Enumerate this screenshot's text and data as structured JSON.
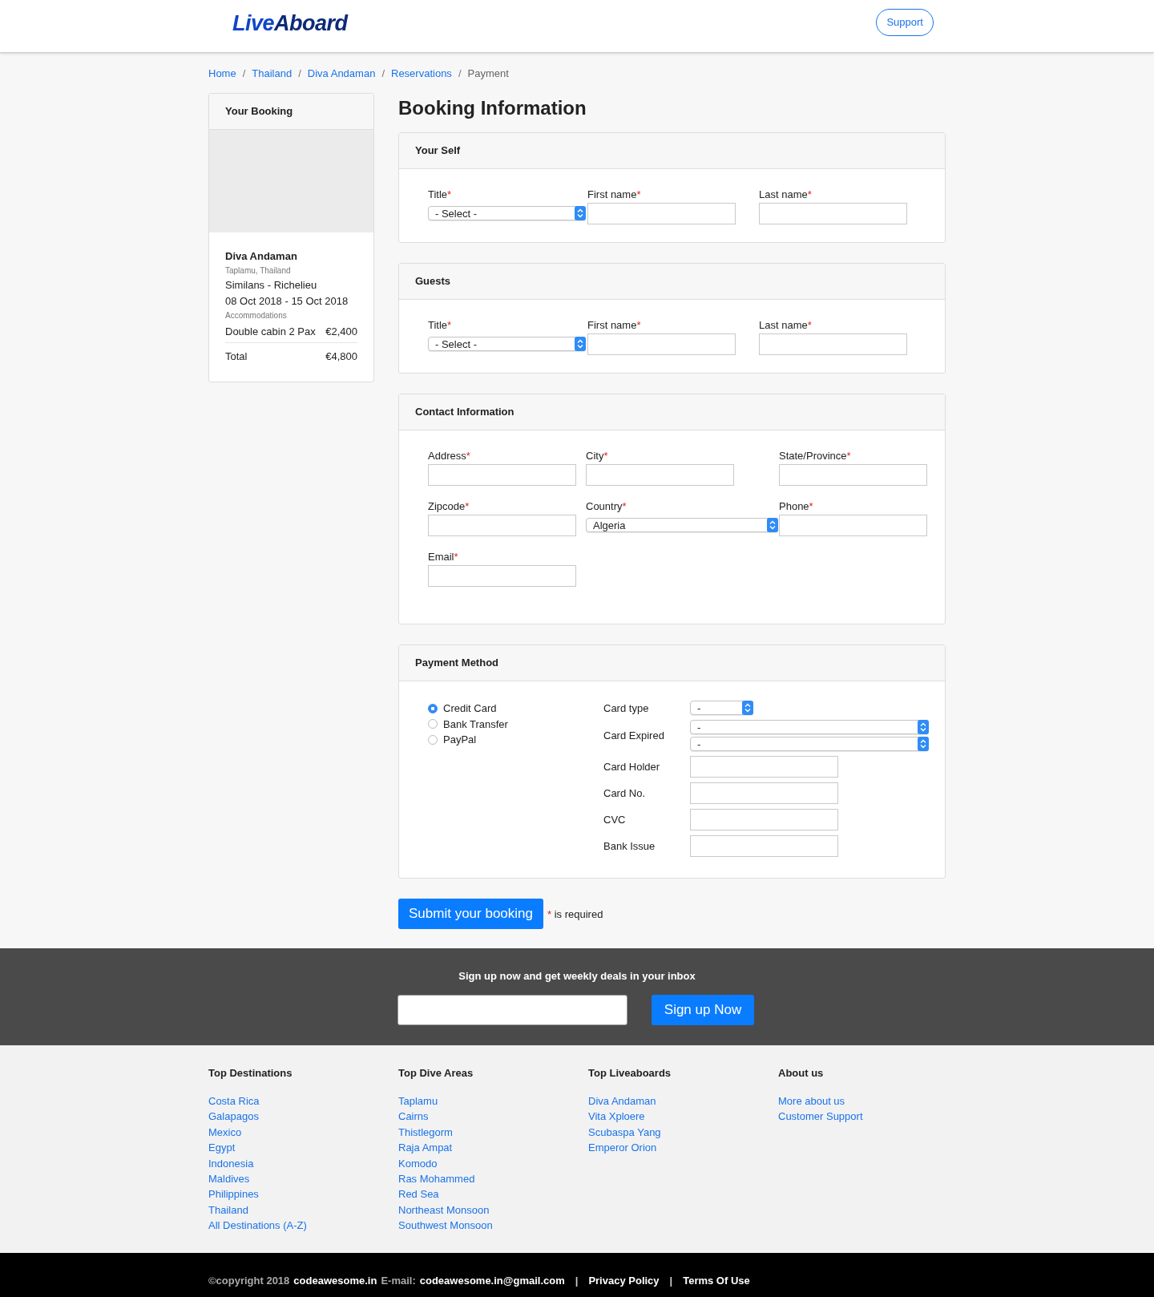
{
  "header": {
    "logo": {
      "part1": "Live",
      "part2": "Aboard"
    },
    "support_button": "Support"
  },
  "breadcrumb": [
    {
      "label": "Home",
      "current": false
    },
    {
      "label": "Thailand",
      "current": false
    },
    {
      "label": "Diva Andaman",
      "current": false
    },
    {
      "label": "Reservations",
      "current": false
    },
    {
      "label": "Payment",
      "current": true
    }
  ],
  "breadcrumb_separator": "/",
  "booking": {
    "title": "Your Booking",
    "boat": "Diva Andaman",
    "location": "Taplamu, Thailand",
    "route": "Similans - Richelieu",
    "dates": "08 Oct 2018 - 15 Oct 2018",
    "accommodations_label": "Accommodations",
    "item": "Double cabin 2 Pax",
    "item_price": "€2,400",
    "total_label": "Total",
    "total": "€4,800"
  },
  "heading": "Booking Information",
  "sections": [
    {
      "title": "Your Self",
      "kind": "three",
      "fields": [
        {
          "label": "Title",
          "mark": "*",
          "kind": "select",
          "value": "- Select -"
        },
        {
          "label": "First name",
          "mark": "*",
          "kind": "input"
        },
        {
          "label": "Last name",
          "mark": "*",
          "kind": "input"
        }
      ]
    },
    {
      "title": "Guests",
      "kind": "three",
      "fields": [
        {
          "label": "Title",
          "mark": "*",
          "kind": "select",
          "value": "- Select -"
        },
        {
          "label": "First name",
          "mark": "*",
          "kind": "input"
        },
        {
          "label": "Last name",
          "mark": "*",
          "kind": "input"
        }
      ]
    },
    {
      "title": "Contact Information",
      "kind": "contact",
      "fields": [
        {
          "label": "Address",
          "mark": "*",
          "kind": "input"
        },
        {
          "label": "City",
          "mark": "*",
          "kind": "input"
        },
        {
          "label": "State/Province",
          "mark": "*",
          "kind": "input"
        },
        {
          "label": "Zipcode",
          "mark": "*",
          "kind": "input"
        },
        {
          "label": "Country",
          "mark": "*",
          "kind": "select",
          "value": "Algeria"
        },
        {
          "label": "Phone",
          "mark": "*",
          "kind": "input"
        },
        {
          "label": "Email",
          "mark": "*",
          "kind": "input"
        }
      ]
    }
  ],
  "payment": {
    "title": "Payment Method",
    "methods": [
      {
        "label": "Credit Card",
        "selected": true
      },
      {
        "label": "Bank Transfer",
        "selected": false
      },
      {
        "label": "PayPal",
        "selected": false
      }
    ],
    "fields": [
      {
        "label": "Card type",
        "kind": "short-select",
        "values": [
          "-"
        ]
      },
      {
        "label": "Card Expired",
        "kind": "wide-select",
        "values": [
          "-",
          "-"
        ]
      },
      {
        "label": "Card Holder",
        "kind": "input"
      },
      {
        "label": "Card No.",
        "kind": "input"
      },
      {
        "label": "CVC",
        "kind": "input"
      },
      {
        "label": "Bank Issue",
        "kind": "input"
      }
    ]
  },
  "submit_button": "Submit your booking",
  "required_note": {
    "mark": "*",
    "text": "is required"
  },
  "newsletter": {
    "text": "Sign up now and get weekly deals in your inbox",
    "button": "Sign up Now"
  },
  "footer_columns": [
    {
      "heading": "Top Destinations",
      "links": [
        "Costa Rica",
        "Galapagos",
        "Mexico",
        "Egypt",
        "Indonesia",
        "Maldives",
        "Philippines",
        "Thailand",
        "All Destinations (A-Z)"
      ]
    },
    {
      "heading": "Top Dive Areas",
      "links": [
        "Taplamu",
        "Cairns",
        "Thistlegorm",
        "Raja Ampat",
        "Komodo",
        "Ras Mohammed",
        "Red Sea",
        "Northeast Monsoon",
        "Southwest Monsoon"
      ]
    },
    {
      "heading": "Top Liveaboards",
      "links": [
        "Diva Andaman",
        "Vita Xploere",
        "Scubaspa Yang",
        "Emperor Orion"
      ]
    },
    {
      "heading": "About us",
      "links": [
        "More about us",
        "Customer Support"
      ]
    }
  ],
  "bottom_bar": [
    {
      "text": "©copyright 2018",
      "kind": "muted"
    },
    {
      "text": "codeawesome.in",
      "kind": "strong"
    },
    {
      "text": "E-mail:",
      "kind": "muted"
    },
    {
      "text": "codeawesome.in@gmail.com",
      "kind": "strong"
    },
    {
      "text": "|",
      "kind": "sep"
    },
    {
      "text": "Privacy Policy",
      "kind": "link"
    },
    {
      "text": "|",
      "kind": "sep"
    },
    {
      "text": "Terms Of Use",
      "kind": "link"
    }
  ]
}
